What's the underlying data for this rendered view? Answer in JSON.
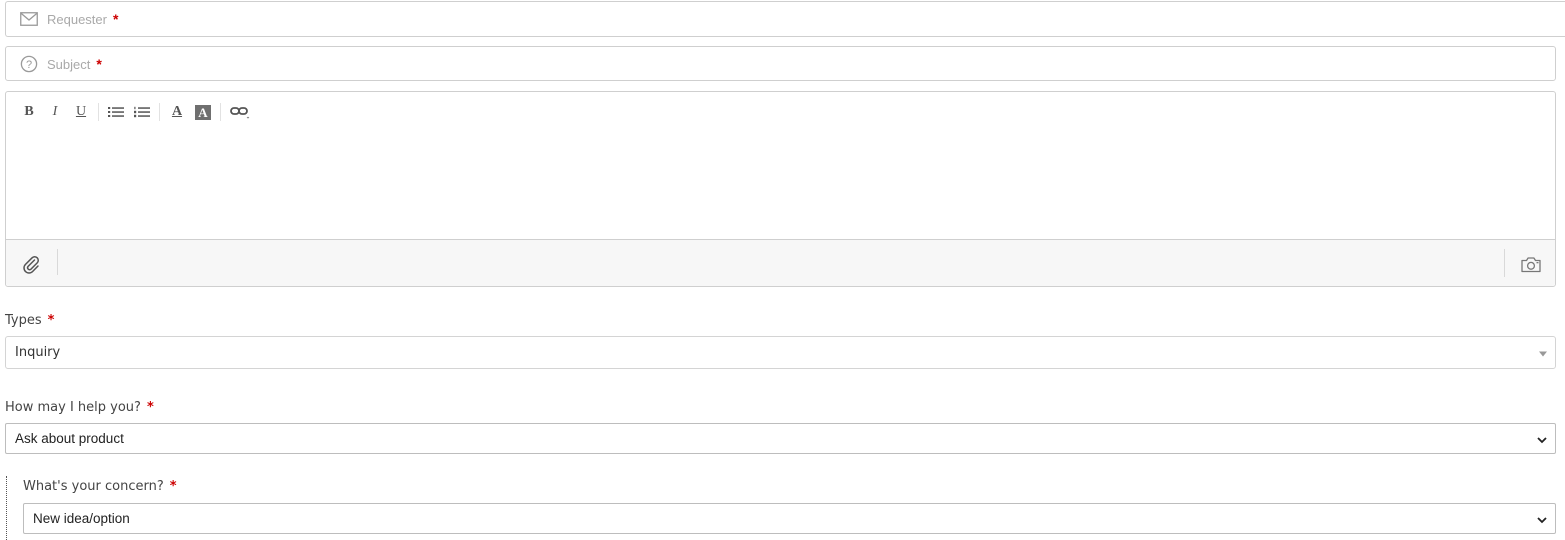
{
  "requester": {
    "placeholder": "Requester",
    "required_mark": "*",
    "icon": "envelope-icon"
  },
  "subject": {
    "placeholder": "Subject",
    "required_mark": "*",
    "icon": "question-circle-icon"
  },
  "editor": {
    "toolbar": {
      "bold": "B",
      "italic": "I",
      "underline": "U",
      "font_color": "A",
      "bg_color": "A"
    },
    "body_text": "",
    "footer": {
      "attach_icon": "paperclip-icon",
      "screenshot_icon": "camera-icon"
    }
  },
  "types": {
    "label": "Types",
    "required_mark": "*",
    "value": "Inquiry"
  },
  "help": {
    "label": "How may I help you?",
    "required_mark": "*",
    "value": "Ask about product"
  },
  "concern": {
    "label": "What's your concern?",
    "required_mark": "*",
    "value": "New idea/option"
  },
  "colors": {
    "required": "#cc0000",
    "border": "#cfcfcf",
    "footer_bg": "#f7f7f7"
  }
}
